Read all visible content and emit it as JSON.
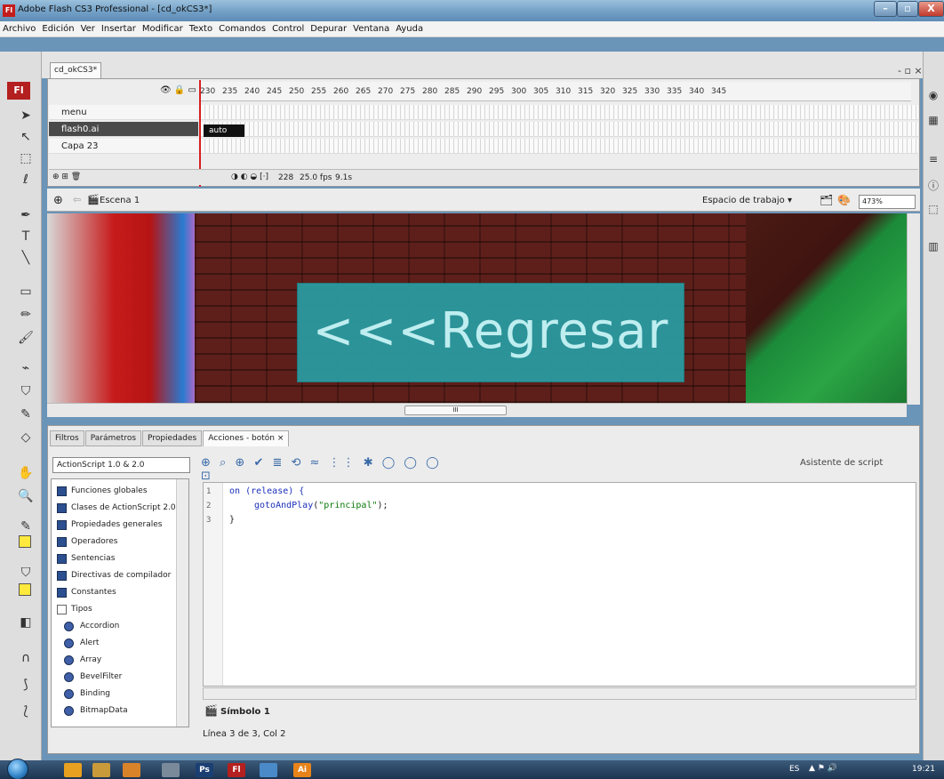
{
  "window": {
    "title": "Adobe Flash CS3 Professional - [cd_okCS3*]",
    "app_icon": "Fl",
    "min": "–",
    "max": "▫",
    "close": "X"
  },
  "menu": [
    "Archivo",
    "Edición",
    "Ver",
    "Insertar",
    "Modificar",
    "Texto",
    "Comandos",
    "Control",
    "Depurar",
    "Ventana",
    "Ayuda"
  ],
  "document": {
    "tab": "cd_okCS3*",
    "controls": "- ▫ ×"
  },
  "toolbar": {
    "logo": "Fl"
  },
  "timeline": {
    "frames": [
      "230",
      "235",
      "240",
      "245",
      "250",
      "255",
      "260",
      "265",
      "270",
      "275",
      "280",
      "285",
      "290",
      "295",
      "300",
      "305",
      "310",
      "315",
      "320",
      "325",
      "330",
      "335",
      "340",
      "345"
    ],
    "layers": [
      {
        "name": "menu",
        "selected": false
      },
      {
        "name": "flash0.ai",
        "selected": true
      },
      {
        "name": "Capa 23",
        "selected": false
      }
    ],
    "frame_label": "auto",
    "current_frame": "228",
    "fps": "25.0 fps",
    "time": "9.1s"
  },
  "scene": {
    "name": "Escena 1",
    "workspace": "Espacio de trabajo ▾",
    "zoom": "473%"
  },
  "stage": {
    "button_text": "<<<Regresar",
    "hscroll_thumb": "III"
  },
  "actions": {
    "tabs": [
      "Filtros",
      "Parámetros",
      "Propiedades",
      "Acciones - botón ×"
    ],
    "language": "ActionScript 1.0 & 2.0",
    "assistant": "Asistente de script",
    "toolbar_icons": "⊕ ⌕ ⊕ ✔ ≣ ⟲ ≈ ⋮⋮ ✱ ◯ ◯ ◯ ⊡",
    "toolbox": [
      {
        "label": "Funciones globales",
        "type": "book"
      },
      {
        "label": "Clases de ActionScript 2.0",
        "type": "book"
      },
      {
        "label": "Propiedades generales",
        "type": "book"
      },
      {
        "label": "Operadores",
        "type": "book"
      },
      {
        "label": "Sentencias",
        "type": "book"
      },
      {
        "label": "Directivas de compilador",
        "type": "book"
      },
      {
        "label": "Constantes",
        "type": "book"
      },
      {
        "label": "Tipos",
        "type": "open"
      },
      {
        "label": "Accordion",
        "type": "sub"
      },
      {
        "label": "Alert",
        "type": "sub"
      },
      {
        "label": "Array",
        "type": "sub"
      },
      {
        "label": "BevelFilter",
        "type": "sub"
      },
      {
        "label": "Binding",
        "type": "sub"
      },
      {
        "label": "BitmapData",
        "type": "sub"
      }
    ],
    "code": {
      "line_numbers": [
        "1",
        "2",
        "3"
      ],
      "line1_kw": "on",
      "line1_rest": " (release) {",
      "line2_fn": "gotoAndPlay",
      "line2_str": "\"principal\"",
      "line2_end": ");",
      "line3": "}"
    },
    "symbol_tab": "Símbolo 1",
    "status": "Línea 3 de 3, Col 2"
  },
  "taskbar": {
    "apps": [
      "",
      "",
      "",
      "",
      "Ps",
      "Fl",
      "",
      "Ai"
    ],
    "lang": "ES",
    "clock": "19:21"
  }
}
